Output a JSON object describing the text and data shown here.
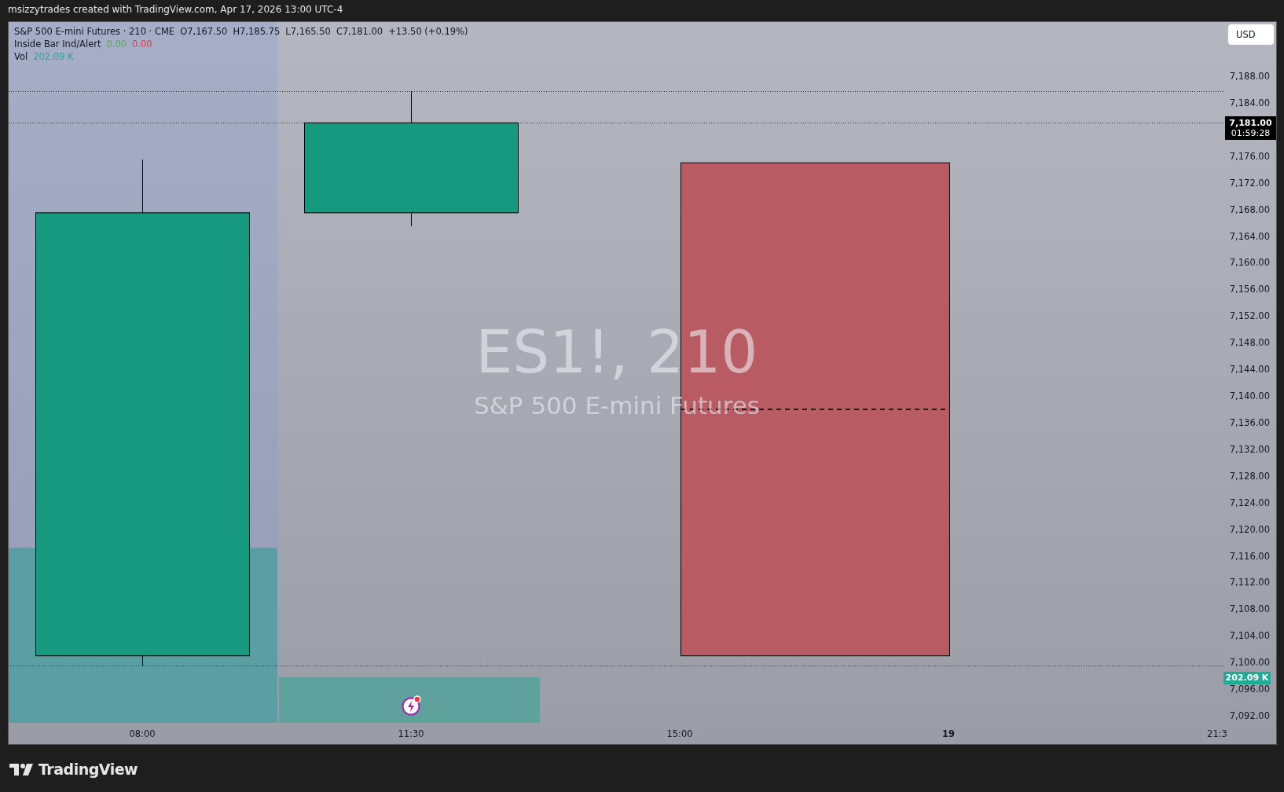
{
  "header": {
    "caption": "msizzytrades created with TradingView.com, Apr 17, 2026 13:00 UTC-4"
  },
  "legend": {
    "symbol": "S&P 500 E-mini Futures · 210 · CME",
    "ohlc": [
      "O7,167.50",
      "H7,185.75",
      "L7,165.50",
      "C7,181.00"
    ],
    "change": "+13.50 (+0.19%)",
    "indicators": [
      {
        "name": "Inside Bar Ind/Alert",
        "values": [
          {
            "text": "0.00",
            "color": "#4caf50"
          },
          {
            "text": "0.00",
            "color": "#f23645"
          }
        ]
      },
      {
        "name": "Vol",
        "values": [
          {
            "text": "202.09 K",
            "color": "#22ab94"
          }
        ]
      }
    ]
  },
  "watermark": {
    "symbol": "ES1!, 210",
    "description": "S&P 500 E-mini Futures"
  },
  "currency_button": "USD",
  "last_price": {
    "price": "7,181.00",
    "countdown": "01:59:28"
  },
  "volume_label": "202.09 K",
  "price_axis": [
    "7,188.00",
    "7,184.00",
    "7,176.00",
    "7,172.00",
    "7,168.00",
    "7,164.00",
    "7,160.00",
    "7,156.00",
    "7,152.00",
    "7,148.00",
    "7,144.00",
    "7,140.00",
    "7,136.00",
    "7,132.00",
    "7,128.00",
    "7,124.00",
    "7,120.00",
    "7,116.00",
    "7,112.00",
    "7,108.00",
    "7,104.00",
    "7,100.00",
    "7,096.00",
    "7,092.00"
  ],
  "time_axis": [
    {
      "label": "08:00",
      "bold": false
    },
    {
      "label": "11:30",
      "bold": false
    },
    {
      "label": "15:00",
      "bold": false
    },
    {
      "label": "19",
      "bold": true
    },
    {
      "label": "21:3",
      "bold": false
    }
  ],
  "footer": {
    "brand": "TradingView"
  }
}
